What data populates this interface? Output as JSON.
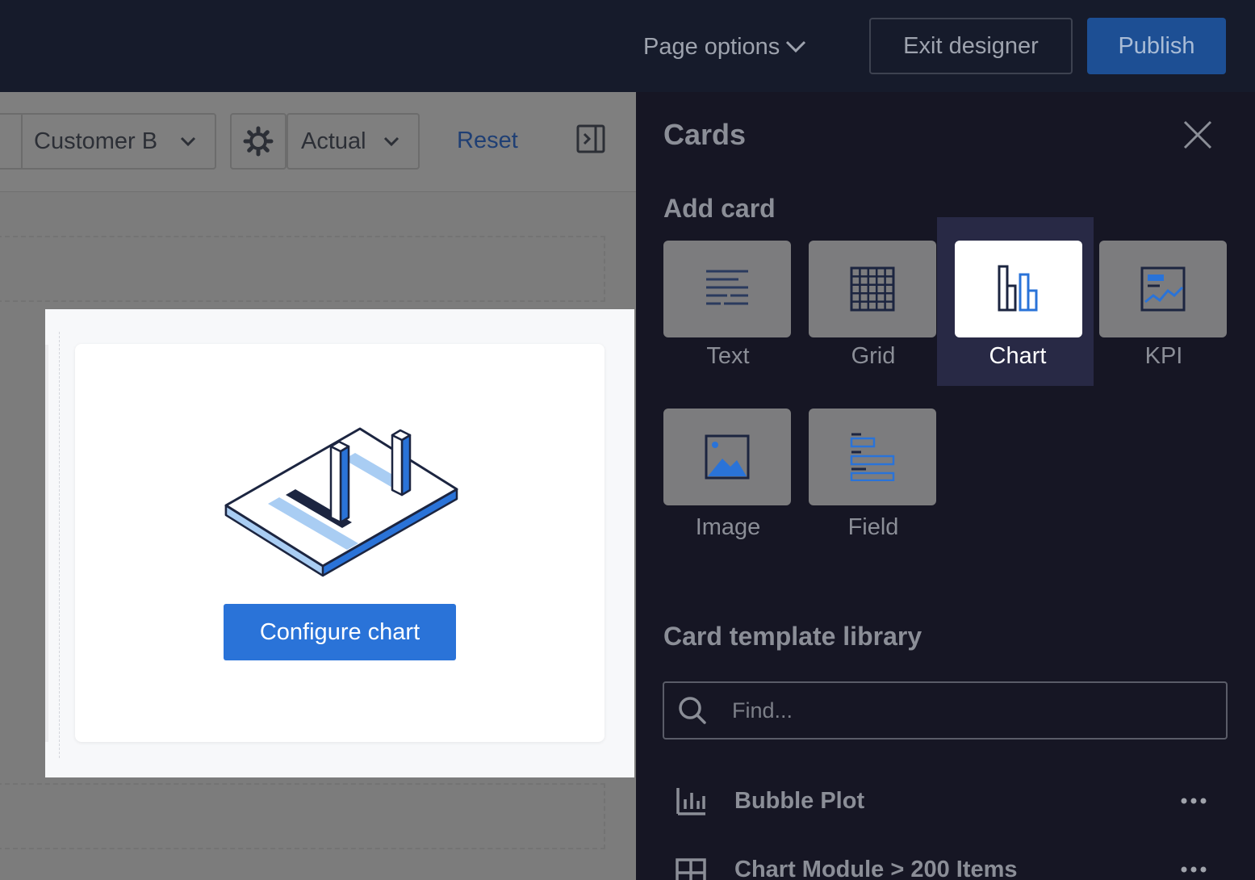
{
  "topbar": {
    "page_options": "Page options",
    "exit_designer": "Exit designer",
    "publish": "Publish"
  },
  "filters": {
    "customer": "Customer B",
    "scenario": "Actual",
    "reset": "Reset"
  },
  "card": {
    "configure_label": "Configure chart"
  },
  "panel": {
    "title": "Cards",
    "add_card": "Add card",
    "tiles": [
      {
        "label": "Text",
        "icon": "text-icon"
      },
      {
        "label": "Grid",
        "icon": "grid-icon"
      },
      {
        "label": "Chart",
        "icon": "bar-chart-icon",
        "selected": true
      },
      {
        "label": "KPI",
        "icon": "kpi-icon"
      },
      {
        "label": "Image",
        "icon": "image-icon"
      },
      {
        "label": "Field",
        "icon": "field-icon"
      }
    ],
    "library_title": "Card template library",
    "search_placeholder": "Find...",
    "library_items": [
      {
        "name": "Bubble Plot",
        "icon": "bar-chart-icon"
      },
      {
        "name": "Chart Module > 200 Items",
        "icon": "grid-icon"
      }
    ]
  },
  "colors": {
    "topbar_bg": "#161b2b",
    "panel_bg": "#161624",
    "publish_bg": "#1d4f94",
    "accent_blue": "#2a73d8",
    "selected_tile_bg": "#282945"
  }
}
